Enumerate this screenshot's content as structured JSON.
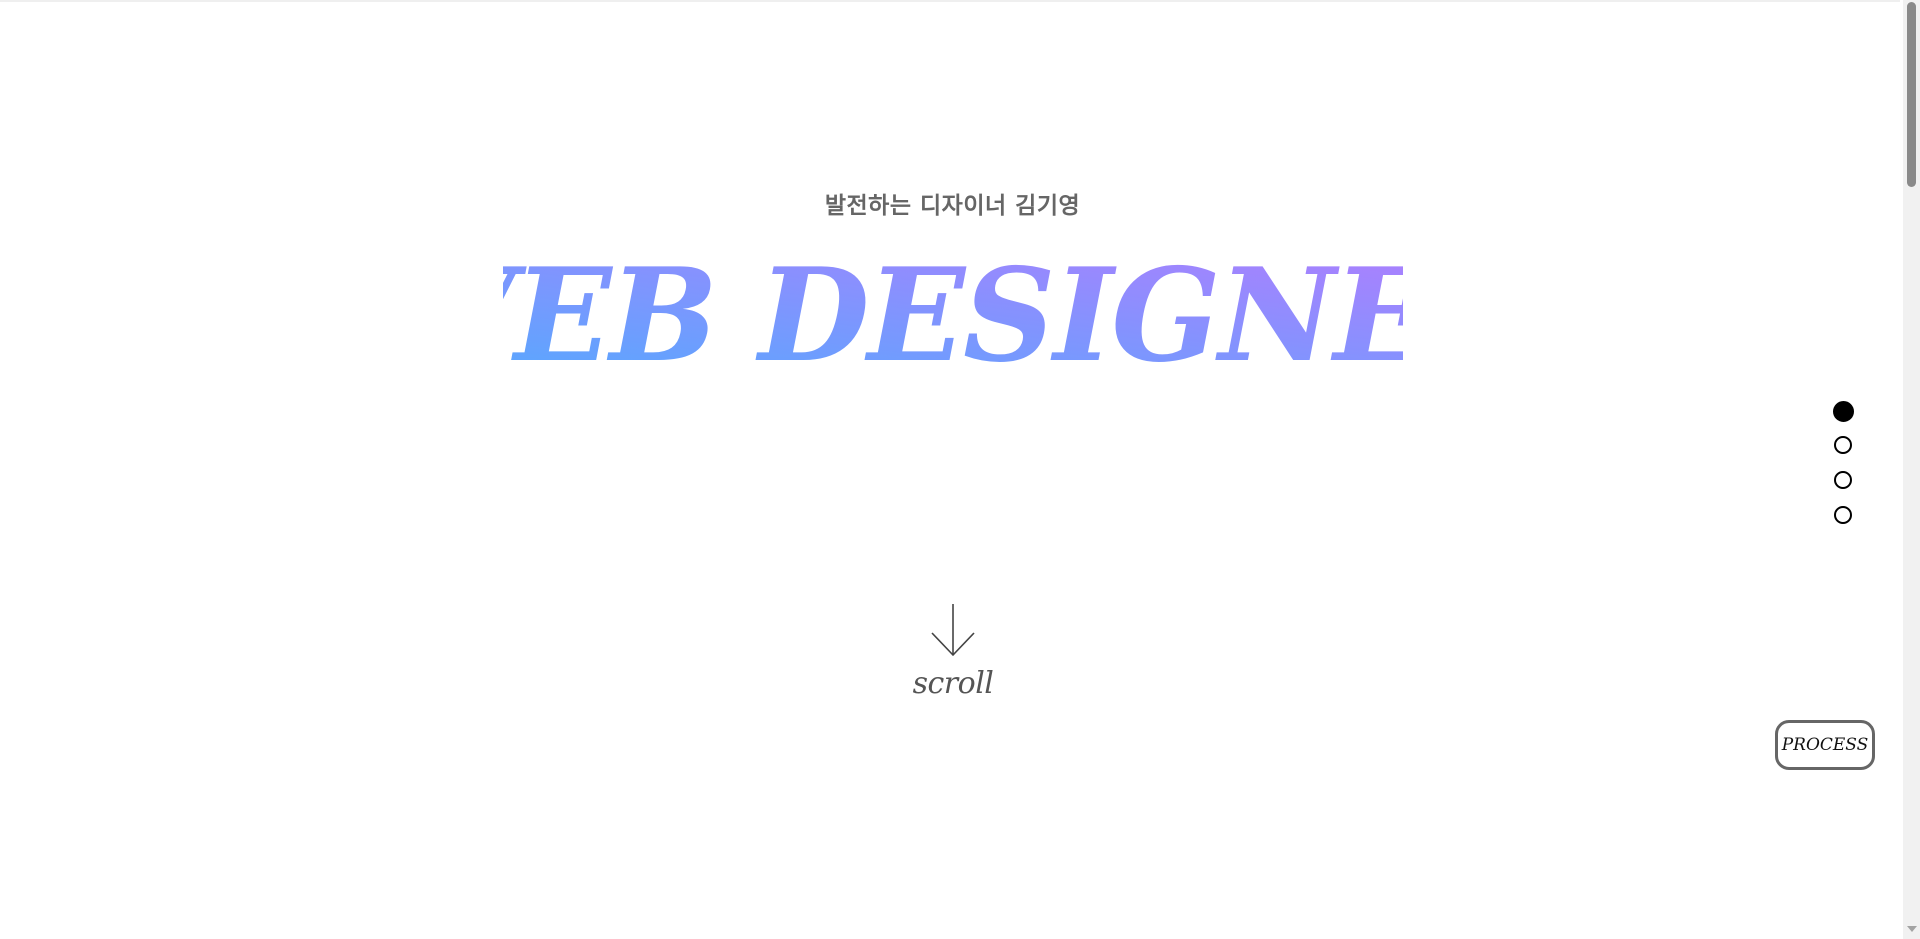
{
  "hero": {
    "subtitle": "발전하는 디자이너 김기영",
    "title": "WEB DESIGNER",
    "gradient_start": "#4facfe",
    "gradient_end": "#b57bfe"
  },
  "scroll_cue": {
    "icon": "arrow-down-icon",
    "label": "scroll"
  },
  "section_nav": {
    "dots": [
      {
        "label": "section-1",
        "active": true
      },
      {
        "label": "section-2",
        "active": false
      },
      {
        "label": "section-3",
        "active": false
      },
      {
        "label": "section-4",
        "active": false
      }
    ]
  },
  "process_button": {
    "label": "PROCESS"
  }
}
